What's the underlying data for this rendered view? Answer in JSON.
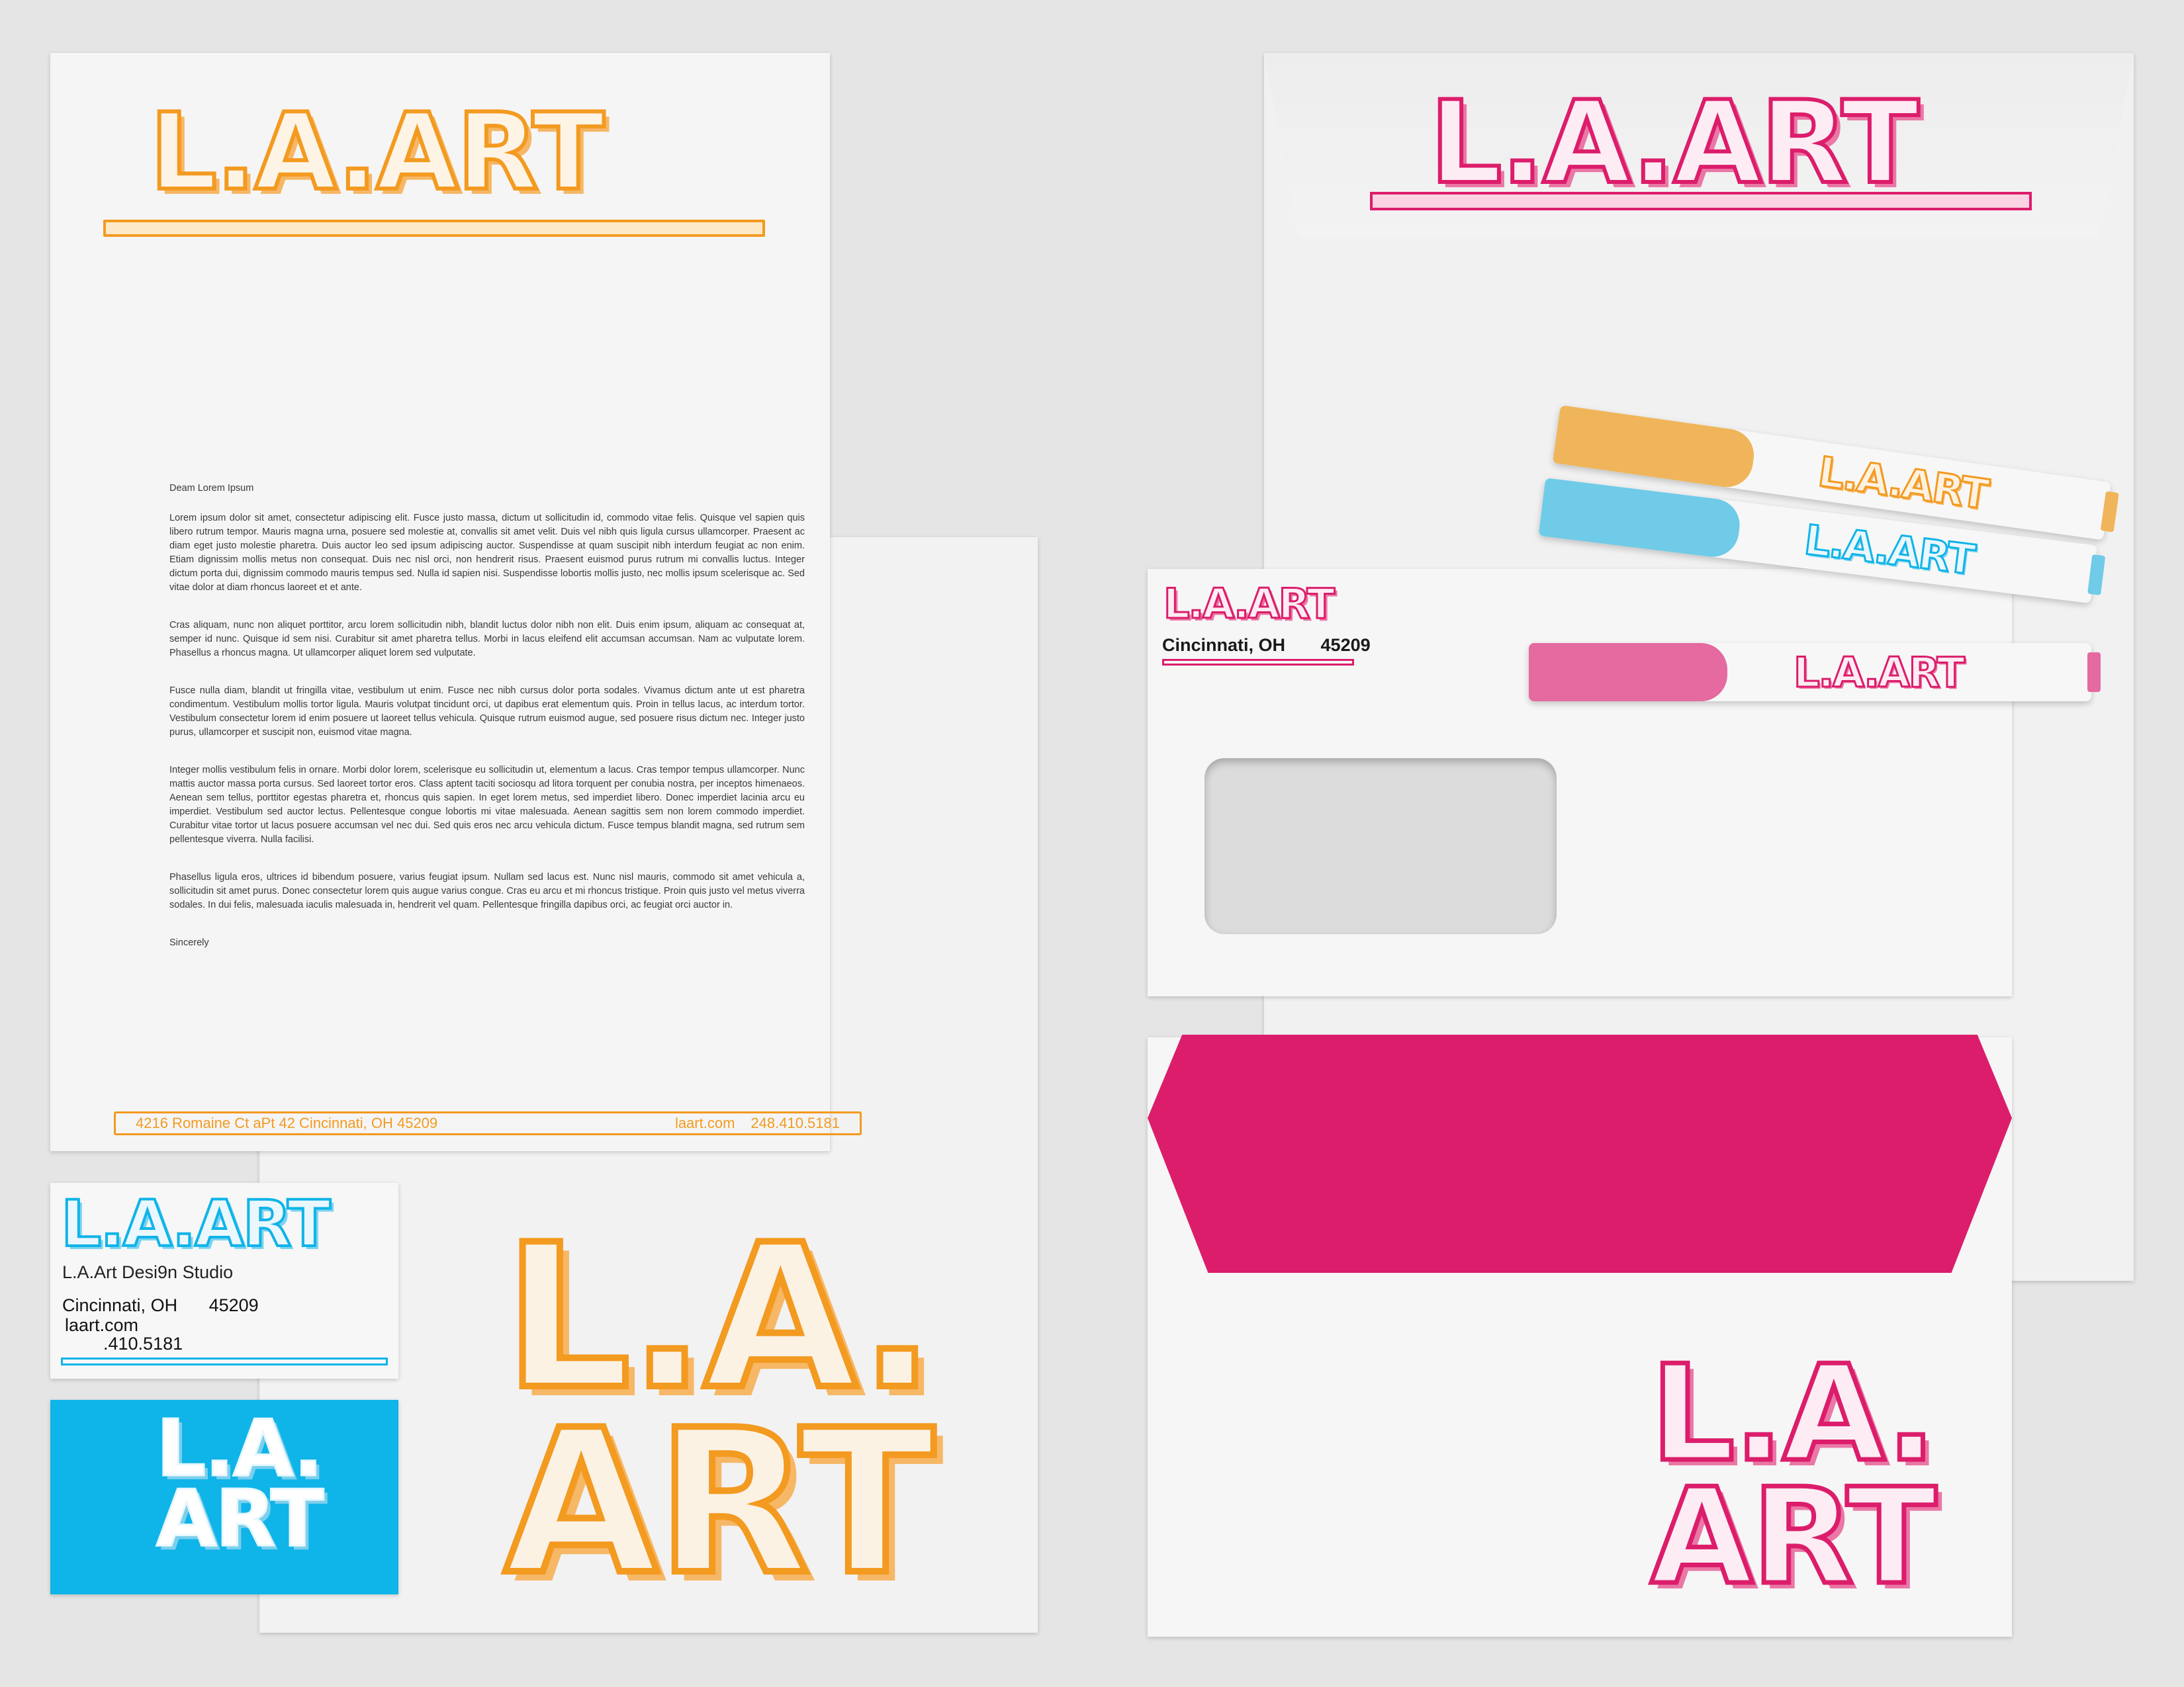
{
  "colors": {
    "orange": "#f39a20",
    "pink": "#dc1d6b",
    "blue": "#0fb4e8",
    "marker_orange": "#f0b55a",
    "marker_blue": "#6fcbe8",
    "marker_pink": "#e46aa0",
    "background": "#e5e5e5",
    "paper": "#f4f4f4"
  },
  "brand": {
    "logo": "L.A.ART",
    "logo_line1": "L.A.",
    "logo_line2": "ART"
  },
  "letterhead": {
    "salutation": "Deam Lorem Ipsum",
    "paragraphs": [
      "Lorem ipsum dolor sit amet, consectetur adipiscing elit. Fusce justo massa, dictum ut sollicitudin id, commodo vitae felis. Quisque vel sapien quis libero rutrum tempor. Mauris magna urna, posuere sed molestie at, convallis sit amet velit. Duis vel nibh quis ligula cursus ullamcorper. Praesent ac diam eget justo molestie pharetra. Duis auctor leo sed ipsum adipiscing auctor. Suspendisse at quam suscipit nibh interdum feugiat ac non enim. Etiam dignissim mollis metus non consequat. Duis nec nisl orci, non hendrerit risus. Praesent euismod purus rutrum mi convallis luctus. Integer dictum porta dui, dignissim commodo mauris tempus sed. Nulla id sapien nisi. Suspendisse lobortis mollis justo, nec mollis ipsum scelerisque ac. Sed vitae dolor at diam rhoncus laoreet et et ante.",
      "Cras aliquam, nunc non aliquet porttitor, arcu lorem sollicitudin nibh, blandit luctus dolor nibh non elit. Duis enim ipsum, aliquam ac consequat at, semper id nunc. Quisque id sem nisi. Curabitur sit amet pharetra tellus. Morbi in lacus eleifend elit accumsan accumsan. Nam ac vulputate lorem. Phasellus a rhoncus magna. Ut ullamcorper aliquet lorem sed vulputate.",
      "Fusce nulla diam, blandit ut fringilla vitae, vestibulum ut enim. Fusce nec nibh cursus dolor porta sodales. Vivamus dictum ante ut est pharetra condimentum. Vestibulum mollis tortor ligula. Mauris volutpat tincidunt orci, ut dapibus erat elementum quis. Proin in tellus lacus, ac interdum tortor. Vestibulum consectetur lorem id enim posuere ut laoreet tellus vehicula. Quisque rutrum euismod augue, sed posuere risus dictum nec. Integer justo purus, ullamcorper et suscipit non, euismod vitae magna.",
      "Integer mollis vestibulum felis in ornare. Morbi dolor lorem, scelerisque eu sollicitudin ut, elementum a lacus. Cras tempor tempus ullamcorper. Nunc mattis auctor massa porta cursus. Sed laoreet tortor eros. Class aptent taciti sociosqu ad litora torquent per conubia nostra, per inceptos himenaeos. Aenean sem tellus, porttitor egestas pharetra et, rhoncus quis sapien. In eget lorem metus, sed imperdiet libero. Donec imperdiet lacinia arcu eu imperdiet. Vestibulum sed auctor lectus. Pellentesque congue lobortis mi vitae malesuada. Aenean sagittis sem non lorem commodo imperdiet. Curabitur vitae tortor ut lacus posuere accumsan vel nec dui. Sed quis eros nec arcu vehicula dictum. Fusce tempus blandit magna, sed rutrum sem pellentesque viverra. Nulla facilisi.",
      "Phasellus ligula eros, ultrices id bibendum posuere, varius feugiat ipsum. Nullam sed lacus est. Nunc nisl mauris, commodo sit amet vehicula a, sollicitudin sit amet purus. Donec consectetur lorem quis augue varius congue. Cras eu arcu et mi rhoncus tristique. Proin quis justo vel metus viverra sodales. In dui felis, malesuada iaculis malesuada in, hendrerit vel quam. Pellentesque fringilla dapibus orci, ac feugiat orci auctor in."
    ],
    "closing": "Sincerely",
    "footer_address": "4216 Romaine Ct aPt 42 Cincinnati, OH 45209",
    "footer_web": "laart.com",
    "footer_phone": "248.410.5181"
  },
  "business_card": {
    "studio": "L.A.Art Desi9n Studio",
    "city": "Cincinnati, OH",
    "zip": "45209",
    "web": "laart.com",
    "phone": ".410.5181"
  },
  "window_envelope": {
    "city": "Cincinnati, OH",
    "zip": "45209"
  },
  "markers": [
    {
      "color": "orange"
    },
    {
      "color": "blue"
    },
    {
      "color": "pink"
    }
  ]
}
